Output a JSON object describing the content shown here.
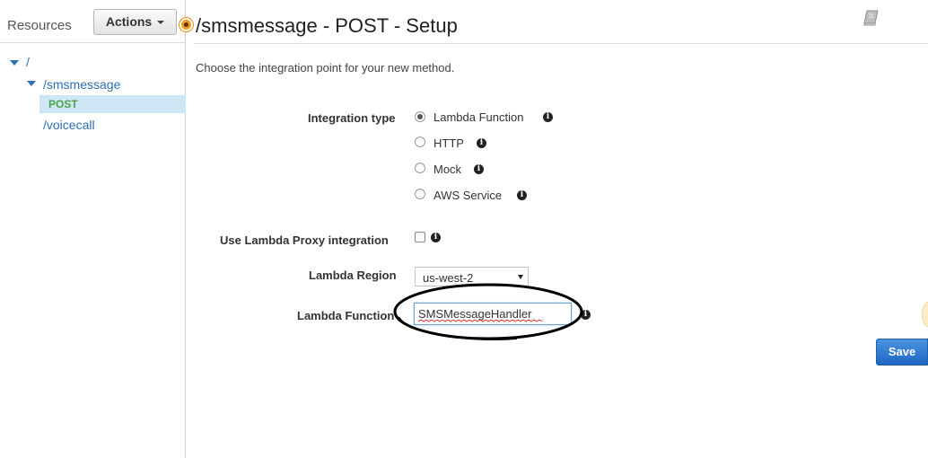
{
  "sidebar": {
    "title": "Resources",
    "actions_label": "Actions",
    "tree": {
      "root": "/",
      "smsmessage": "/smsmessage",
      "post_method": "POST",
      "voicecall": "/voicecall"
    }
  },
  "header": {
    "title": "/smsmessage - POST - Setup",
    "book_icon": "book-icon"
  },
  "main": {
    "intro": "Choose the integration point for your new method.",
    "integration_type": {
      "label": "Integration type",
      "selected": "Lambda Function",
      "options": [
        "Lambda Function",
        "HTTP",
        "Mock",
        "AWS Service"
      ]
    },
    "proxy": {
      "label": "Use Lambda Proxy integration",
      "checked": false
    },
    "region": {
      "label": "Lambda Region",
      "value": "us-west-2"
    },
    "function": {
      "label": "Lambda Function",
      "value": "SMSMessageHandler"
    },
    "save_label": "Save"
  },
  "colors": {
    "accent_blue": "#2f6fb3",
    "save_blue": "#1e67c3",
    "method_green": "#49a54a",
    "selected_row": "#cfe6f6",
    "status_orange": "#f39a1e"
  }
}
